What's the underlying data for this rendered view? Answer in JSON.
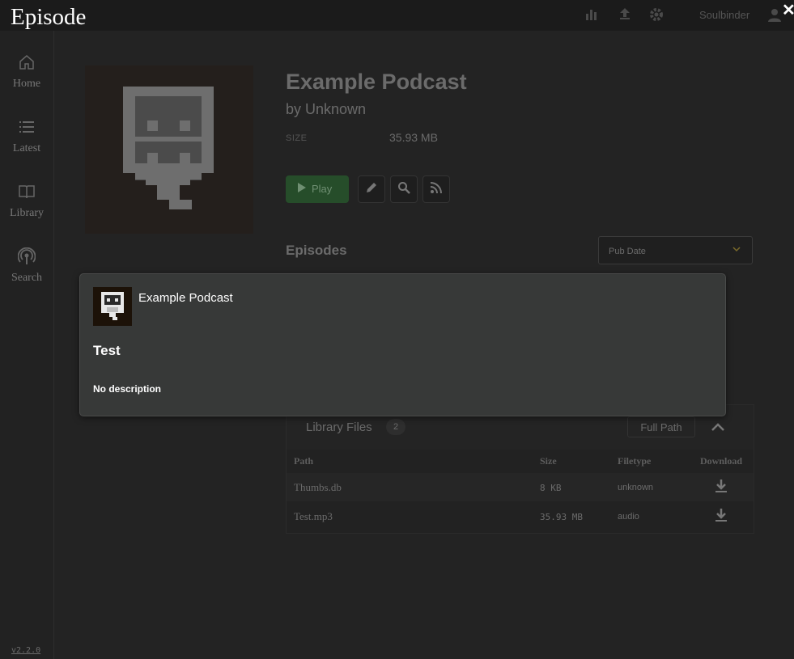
{
  "topbar": {
    "username": "Soulbinder"
  },
  "sidebar": {
    "items": [
      {
        "label": "Home",
        "icon": "home-icon"
      },
      {
        "label": "Latest",
        "icon": "list-icon"
      },
      {
        "label": "Library",
        "icon": "book-icon"
      },
      {
        "label": "Search",
        "icon": "podcast-icon"
      }
    ],
    "version": "v2.2.0"
  },
  "podcast": {
    "title": "Example Podcast",
    "author": "by Unknown",
    "size_label": "SIZE",
    "size_value": "35.93 MB",
    "play_label": "Play"
  },
  "episodes": {
    "title": "Episodes",
    "sort_value": "Pub Date"
  },
  "library_files": {
    "title": "Library Files",
    "count": "2",
    "full_path_label": "Full Path",
    "columns": [
      "Path",
      "Size",
      "Filetype",
      "Download"
    ],
    "rows": [
      {
        "path": "Thumbs.db",
        "size": "8 KB",
        "filetype": "unknown"
      },
      {
        "path": "Test.mp3",
        "size": "35.93 MB",
        "filetype": "audio"
      }
    ]
  },
  "modal": {
    "heading": "Episode",
    "podcast_name": "Example Podcast",
    "episode_title": "Test",
    "description": "No description"
  },
  "colors": {
    "play_green": "#264d2a",
    "modal_bg": "#373938",
    "accent_chevron": "#7a6a2a"
  }
}
